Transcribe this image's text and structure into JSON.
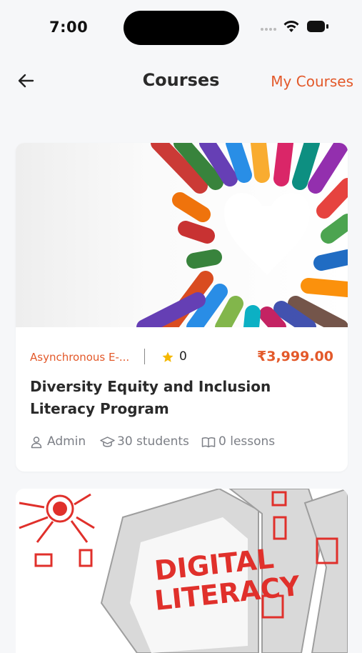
{
  "status_bar": {
    "time": "7:00"
  },
  "header": {
    "title": "Courses",
    "my_courses_label": "My Courses"
  },
  "courses": [
    {
      "category": "Asynchronous E-...",
      "rating": "0",
      "price": "₹3,999.00",
      "title": "Diversity Equity and Inclusion Literacy Program",
      "author": "Admin",
      "students": "30 students",
      "lessons": "0 lessons"
    },
    {
      "image_text_line1": "DIGITAL",
      "image_text_line2": "LITERACY"
    }
  ],
  "colors": {
    "accent": "#e3592a",
    "star": "#f5b800",
    "background": "#f6f7f9"
  },
  "icons": [
    "back-arrow-icon",
    "star-icon",
    "user-icon",
    "graduation-cap-icon",
    "book-icon",
    "wifi-icon",
    "battery-icon",
    "signal-icon"
  ]
}
